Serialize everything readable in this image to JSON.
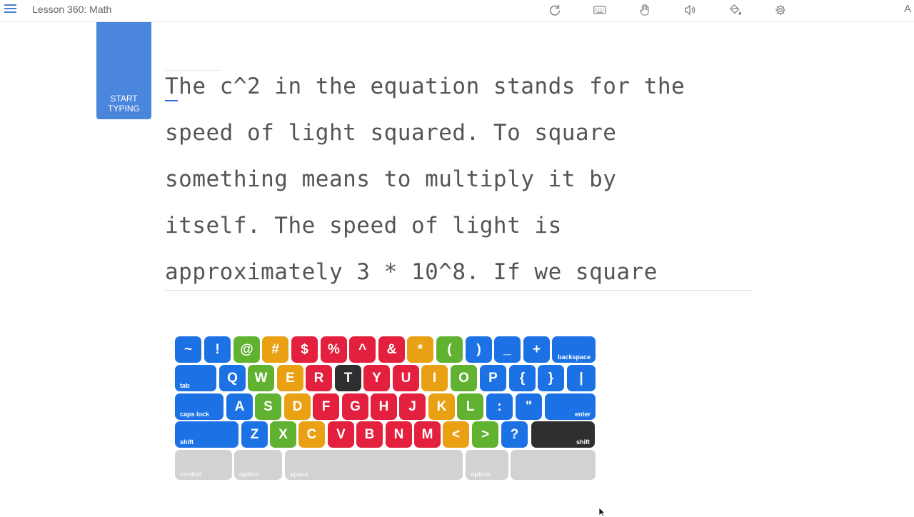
{
  "topbar": {
    "title": "Lesson 360: Math",
    "icons": [
      "menu-icon",
      "refresh-icon",
      "keyboard-icon",
      "hand-icon",
      "sound-icon",
      "paint-bucket-icon",
      "gear-icon"
    ],
    "font_label": "A"
  },
  "start_card": {
    "line1": "START",
    "line2": "TYPING"
  },
  "passage": {
    "lines": [
      "The c^2 in the equation stands for the",
      "speed of light squared. To square",
      "something means to multiply it by",
      "itself. The speed of light is",
      "approximately 3 * 10^8. If we square"
    ]
  },
  "keyboard": {
    "row1": [
      {
        "label": "~",
        "color": "blue"
      },
      {
        "label": "!",
        "color": "blue"
      },
      {
        "label": "@",
        "color": "green"
      },
      {
        "label": "#",
        "color": "orange"
      },
      {
        "label": "$",
        "color": "red"
      },
      {
        "label": "%",
        "color": "red"
      },
      {
        "label": "^",
        "color": "red"
      },
      {
        "label": "&",
        "color": "red"
      },
      {
        "label": "*",
        "color": "orange"
      },
      {
        "label": "(",
        "color": "green"
      },
      {
        "label": ")",
        "color": "blue"
      },
      {
        "label": "_",
        "color": "blue"
      },
      {
        "label": "+",
        "color": "blue"
      },
      {
        "label": "backspace",
        "color": "blue"
      }
    ],
    "row2": [
      {
        "label": "tab",
        "color": "blue"
      },
      {
        "label": "Q",
        "color": "blue"
      },
      {
        "label": "W",
        "color": "green"
      },
      {
        "label": "E",
        "color": "orange"
      },
      {
        "label": "R",
        "color": "red"
      },
      {
        "label": "T",
        "color": "dark"
      },
      {
        "label": "Y",
        "color": "red"
      },
      {
        "label": "U",
        "color": "red"
      },
      {
        "label": "I",
        "color": "orange"
      },
      {
        "label": "O",
        "color": "green"
      },
      {
        "label": "P",
        "color": "blue"
      },
      {
        "label": "{",
        "color": "blue"
      },
      {
        "label": "}",
        "color": "blue"
      },
      {
        "label": "|",
        "color": "blue"
      }
    ],
    "row3": [
      {
        "label": "caps lock",
        "color": "blue"
      },
      {
        "label": "A",
        "color": "blue"
      },
      {
        "label": "S",
        "color": "green"
      },
      {
        "label": "D",
        "color": "orange"
      },
      {
        "label": "F",
        "color": "red"
      },
      {
        "label": "G",
        "color": "red"
      },
      {
        "label": "H",
        "color": "red"
      },
      {
        "label": "J",
        "color": "red"
      },
      {
        "label": "K",
        "color": "orange"
      },
      {
        "label": "L",
        "color": "green"
      },
      {
        "label": ":",
        "color": "blue"
      },
      {
        "label": "\"",
        "color": "blue"
      },
      {
        "label": "enter",
        "color": "blue"
      }
    ],
    "row4": [
      {
        "label": "shift",
        "color": "blue"
      },
      {
        "label": "Z",
        "color": "blue"
      },
      {
        "label": "X",
        "color": "green"
      },
      {
        "label": "C",
        "color": "orange"
      },
      {
        "label": "V",
        "color": "red"
      },
      {
        "label": "B",
        "color": "red"
      },
      {
        "label": "N",
        "color": "red"
      },
      {
        "label": "M",
        "color": "red"
      },
      {
        "label": "<",
        "color": "orange"
      },
      {
        "label": ">",
        "color": "green"
      },
      {
        "label": "?",
        "color": "blue"
      },
      {
        "label": "shift",
        "color": "dark"
      }
    ],
    "row5": [
      {
        "label": "control"
      },
      {
        "label": "option"
      },
      {
        "label": "space"
      },
      {
        "label": "option"
      },
      {
        "label": ""
      }
    ],
    "highlighted_keys": [
      "T",
      "shift (right)"
    ],
    "colors": {
      "blue": "#1c72e4",
      "green": "#62b231",
      "orange": "#e9a113",
      "red": "#e3213e",
      "dark": "#2f2f2f",
      "inactive": "#d2d2d2"
    }
  }
}
